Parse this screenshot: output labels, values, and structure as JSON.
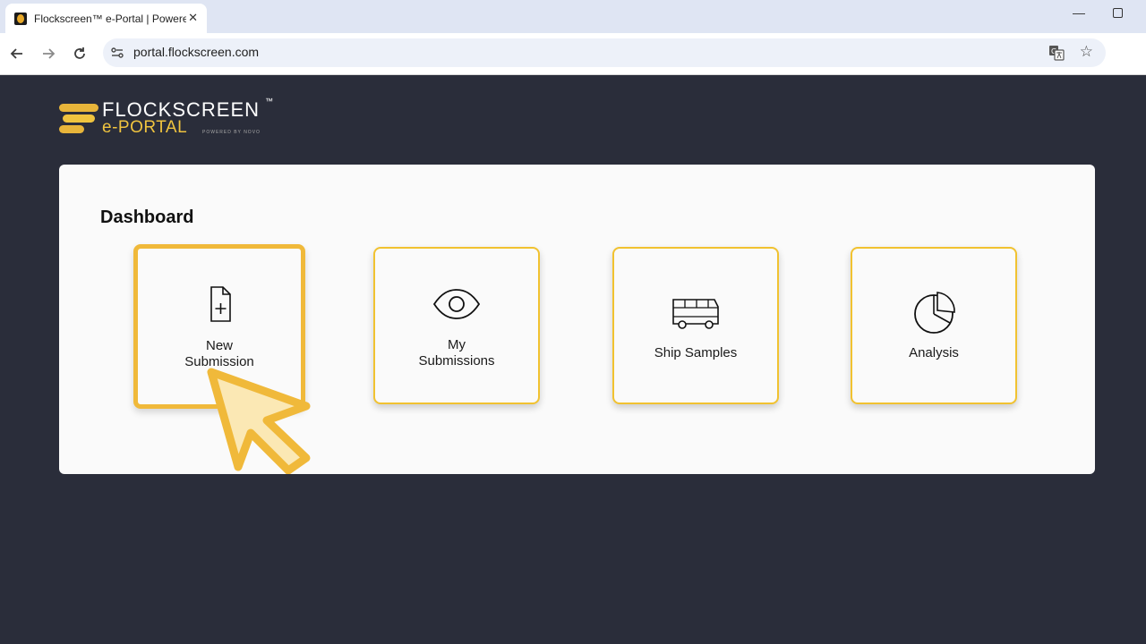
{
  "browser": {
    "tab_title": "Flockscreen™ e-Portal | Powered by Novo",
    "tab_close": "✕",
    "url": "portal.flockscreen.com",
    "star": "☆",
    "minimize": "—"
  },
  "logo": {
    "brand_name": "FLOCKSCREEN",
    "trademark": "™",
    "portal": "e-PORTAL",
    "powered": "POWERED BY NOVO"
  },
  "dashboard": {
    "title": "Dashboard",
    "cards": [
      {
        "label": "New\nSubmission",
        "icon": "file-plus-icon"
      },
      {
        "label": "My\nSubmissions",
        "icon": "eye-icon"
      },
      {
        "label": "Ship Samples",
        "icon": "van-icon"
      },
      {
        "label": "Analysis",
        "icon": "pie-chart-icon"
      }
    ]
  },
  "colors": {
    "page_bg": "#2a2d3a",
    "accent": "#f1c230",
    "panel_bg": "#fafafa"
  }
}
